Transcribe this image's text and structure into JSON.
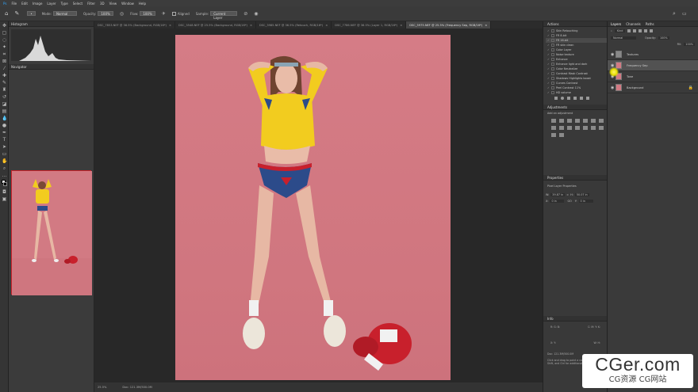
{
  "menubar": {
    "items": [
      "File",
      "Edit",
      "Image",
      "Layer",
      "Type",
      "Select",
      "Filter",
      "3D",
      "View",
      "Window",
      "Help"
    ]
  },
  "options": {
    "mode_label": "Mode:",
    "mode_value": "Normal",
    "opacity_label": "Opacity:",
    "opacity_value": "100%",
    "flow_label": "Flow:",
    "flow_value": "100%",
    "aligned_label": "Aligned",
    "sample_label": "Sample:",
    "sample_value": "Current Layer"
  },
  "left": {
    "histogram_title": "Histogram",
    "navigator_title": "Navigator"
  },
  "tabs": [
    {
      "label": "DSC_7853.NEF @ 36.5% (Background, RGB/16*)",
      "active": false
    },
    {
      "label": "DSC_3548.NEF @ 25.5% (Background, RGB/16*)",
      "active": false
    },
    {
      "label": "DSC_3985.NEF @ 36.5% (Retouch, RGB/16*)",
      "active": false
    },
    {
      "label": "DSC_7786.NEF @ 36.5% (Layer 1, RGB/16*)",
      "active": false
    },
    {
      "label": "DSC_5975.NEF @ 25.5% (Frequency Sep, RGB/16*)",
      "active": true
    }
  ],
  "status": {
    "zoom": "25.5%",
    "doc": "Doc: 121.3M/500.0M"
  },
  "actions": {
    "title": "Actions",
    "rows": [
      {
        "label": "Skin Retouching",
        "checked": true,
        "selected": false
      },
      {
        "label": "FR 8-bit",
        "checked": true,
        "selected": false
      },
      {
        "label": "FR 16-bit",
        "checked": true,
        "selected": true
      },
      {
        "label": "FR skin clean",
        "checked": true,
        "selected": false
      },
      {
        "label": "Color Layer",
        "checked": true,
        "selected": false
      },
      {
        "label": "Noise texture",
        "checked": true,
        "selected": false
      },
      {
        "label": "Enhance",
        "checked": true,
        "selected": false
      },
      {
        "label": "Enhance light and dark",
        "checked": true,
        "selected": false
      },
      {
        "label": "Color Neutralize",
        "checked": true,
        "selected": false
      },
      {
        "label": "Contrast Mask Contrast",
        "checked": true,
        "selected": false
      },
      {
        "label": "Shadows Highlights boost",
        "checked": true,
        "selected": false
      },
      {
        "label": "Curves Contrast",
        "checked": true,
        "selected": false
      },
      {
        "label": "Peel Contrast 11%",
        "checked": true,
        "selected": false
      },
      {
        "label": "HD volume",
        "checked": true,
        "selected": false
      }
    ]
  },
  "adjustments": {
    "title": "Adjustments",
    "subtitle": "Add an adjustment"
  },
  "properties": {
    "title": "Properties",
    "subtitle": "Pixel Layer Properties",
    "w_label": "W:",
    "w_value": "39.87 in",
    "h_label": "H:",
    "h_value": "50.07 in",
    "go_label": "GO",
    "x_label": "X:",
    "x_value": "0 in",
    "y_label": "Y:",
    "y_value": "0 in"
  },
  "info": {
    "title": "Info",
    "doc": "Doc: 121.3M/500.0M",
    "hint": "Click and drag to paint a color. Use Alt, Shift, and Ctrl for additional options."
  },
  "layers": {
    "tab_layers": "Layers",
    "tab_channels": "Channels",
    "tab_paths": "Paths",
    "kind_label": "Kind",
    "mode_value": "Normal",
    "opacity_label": "Opacity:",
    "opacity_value": "100%",
    "fill_label": "Fill:",
    "fill_value": "100%",
    "items": [
      {
        "name": "Textures",
        "thumb": "#888888",
        "selected": false
      },
      {
        "name": "Frequency Sep",
        "thumb": "#d27a83",
        "selected": true
      },
      {
        "name": "Tone",
        "thumb": "#d27a83",
        "selected": false
      },
      {
        "name": "Background",
        "thumb": "#d27a83",
        "selected": false
      }
    ]
  },
  "watermark": {
    "line1": "CGer.com",
    "line2": "CG资源 CG网站"
  },
  "colors": {
    "backdrop": "#d27a83",
    "sweater": "#f2cc1f",
    "shorts": "#2c4b8a",
    "gloves": "#c8202c"
  }
}
